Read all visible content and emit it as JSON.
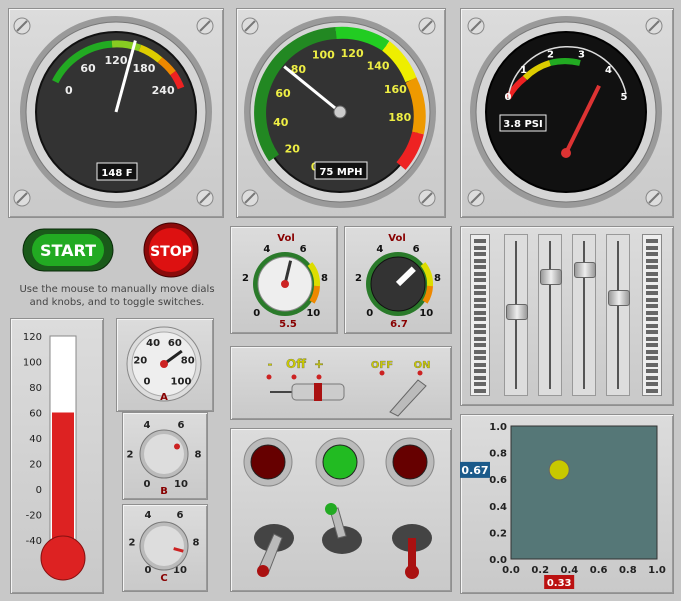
{
  "gauges": {
    "temperature": {
      "ticks": [
        "0",
        "60",
        "120",
        "180",
        "240"
      ],
      "value": 148,
      "readout": "148 F"
    },
    "speed": {
      "ticks": [
        "0",
        "20",
        "40",
        "60",
        "80",
        "100",
        "120",
        "140",
        "160",
        "180"
      ],
      "value": 75,
      "readout": "75 MPH"
    },
    "pressure": {
      "ticks": [
        "0",
        "1",
        "2",
        "3",
        "4",
        "5"
      ],
      "value": 3.8,
      "readout": "3.8 PSI"
    }
  },
  "buttons": {
    "start": "START",
    "stop": "STOP"
  },
  "instructions": "Use the mouse to manually move dials and knobs, and to toggle switches.",
  "volume_knobs": [
    {
      "title": "Vol",
      "ticks": [
        "0",
        "2",
        "4",
        "6",
        "8",
        "10"
      ],
      "value": 5.5,
      "readout": "5.5"
    },
    {
      "title": "Vol",
      "ticks": [
        "0",
        "2",
        "4",
        "6",
        "8",
        "10"
      ],
      "value": 6.7,
      "readout": "6.7"
    }
  ],
  "thermometer": {
    "ticks": [
      "120",
      "100",
      "80",
      "60",
      "40",
      "20",
      "0",
      "-20",
      "-40"
    ],
    "value": 60
  },
  "dial_a": {
    "ticks": [
      "0",
      "20",
      "40",
      "60",
      "80",
      "100"
    ],
    "label": "A",
    "value": 70
  },
  "knob_b": {
    "ticks": [
      "0",
      "2",
      "4",
      "6",
      "8",
      "10"
    ],
    "label": "B",
    "value": 7
  },
  "knob_c": {
    "ticks": [
      "0",
      "2",
      "4",
      "6",
      "8",
      "10"
    ],
    "label": "C",
    "value": 8.5
  },
  "switches": {
    "minus": "-",
    "off": "Off",
    "plus": "+",
    "toggle_off": "OFF",
    "toggle_on": "ON"
  },
  "sliders": [
    0.55,
    0.8,
    0.85,
    0.65
  ],
  "level_meters": [
    0.0,
    0.0
  ],
  "lights": {
    "colors": [
      "#cc1111",
      "#22bb22",
      "#cc1111"
    ],
    "lit": [
      false,
      true,
      false
    ]
  },
  "xy_pad": {
    "x_ticks": [
      "0.0",
      "0.2",
      "0.4",
      "0.6",
      "0.8",
      "1.0"
    ],
    "y_ticks": [
      "1.0",
      "0.8",
      "0.6",
      "0.4",
      "0.2",
      "0.0"
    ],
    "x": 0.33,
    "y": 0.67,
    "x_readout": "0.33",
    "y_readout": "0.67",
    "background": "#557777",
    "ball_color": "#c8c800"
  }
}
